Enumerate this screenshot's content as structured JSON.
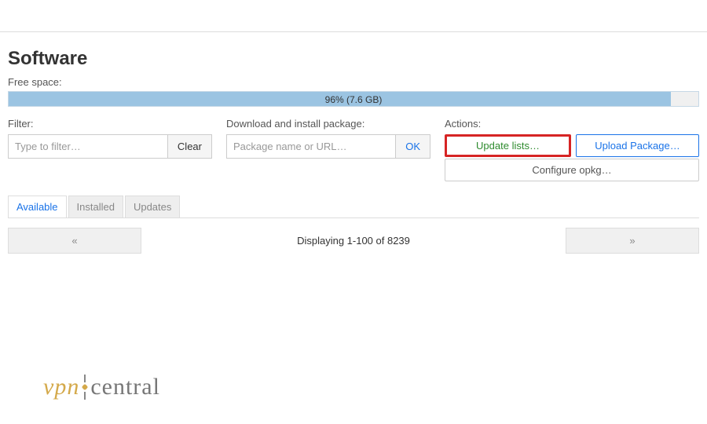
{
  "page": {
    "title": "Software",
    "free_space_label": "Free space:",
    "progress_text": "96% (7.6 GB)",
    "progress_percent": 96
  },
  "filter": {
    "label": "Filter:",
    "placeholder": "Type to filter…",
    "value": "",
    "clear_label": "Clear"
  },
  "package": {
    "label": "Download and install package:",
    "placeholder": "Package name or URL…",
    "value": "",
    "ok_label": "OK"
  },
  "actions": {
    "label": "Actions:",
    "update_label": "Update lists…",
    "upload_label": "Upload Package…",
    "opkg_label": "Configure opkg…"
  },
  "tabs": {
    "available": "Available",
    "installed": "Installed",
    "updates": "Updates"
  },
  "pager": {
    "prev": "«",
    "next": "»",
    "display": "Displaying 1-100 of 8239"
  },
  "watermark": {
    "left": "vpn",
    "right": "central"
  }
}
